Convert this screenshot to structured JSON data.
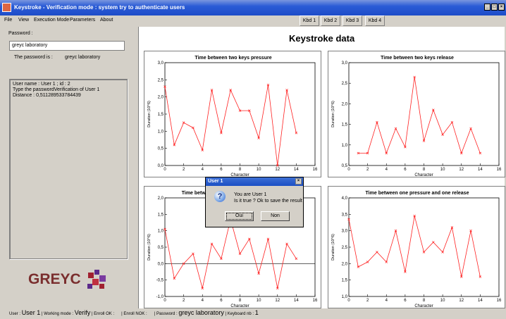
{
  "window": {
    "title": "Keystroke - Verification mode : system try to authenticate users"
  },
  "menu": [
    "File",
    "View",
    "Execution Mode",
    "Parameters",
    "About"
  ],
  "keyboards": [
    "Kbd 1",
    "Kbd 2",
    "Kbd 3",
    "Kbd 4"
  ],
  "left": {
    "password_label": "Password :",
    "password_value": "greyc laboratory",
    "password_is_label": "The password is :",
    "password_is_value": "greyc laboratory",
    "info_lines": [
      "User name : User 1 ; id : 2",
      "Type the passwordVerification of User 1",
      "Distance : 0,511289533784439"
    ],
    "logo_text": "GREYC"
  },
  "main": {
    "title": "Keystroke data"
  },
  "charts": [
    {
      "title": "Time between two keys pressure"
    },
    {
      "title": "Time between two keys release"
    },
    {
      "title": "Time between two pressure and one release"
    },
    {
      "title": "Time between one pressure and one release"
    }
  ],
  "chart_data": [
    {
      "type": "line",
      "title": "Time between two keys pressure",
      "xlabel": "Character",
      "ylabel": "Duration (10^6)",
      "xlim": [
        0,
        16
      ],
      "ylim": [
        0,
        3
      ],
      "xticks": [
        0,
        2,
        4,
        6,
        8,
        10,
        12,
        14,
        16
      ],
      "yticks": [
        "0,0",
        "0,5",
        "1,0",
        "1,5",
        "2,0",
        "2,5",
        "3,0"
      ],
      "x": [
        0,
        1,
        2,
        3,
        4,
        5,
        6,
        7,
        8,
        9,
        10,
        11,
        12,
        13,
        14
      ],
      "y": [
        2.3,
        0.6,
        1.25,
        1.1,
        0.45,
        2.2,
        0.95,
        2.2,
        1.6,
        1.6,
        0.8,
        2.35,
        0.0,
        2.2,
        0.95
      ]
    },
    {
      "type": "line",
      "title": "Time between two keys release",
      "xlabel": "Character",
      "ylabel": "Duration (10^6)",
      "xlim": [
        0,
        16
      ],
      "ylim": [
        0.5,
        3
      ],
      "xticks": [
        0,
        2,
        4,
        6,
        8,
        10,
        12,
        14,
        16
      ],
      "yticks": [
        "0,5",
        "1,0",
        "1,5",
        "2,0",
        "2,5",
        "3,0"
      ],
      "x": [
        1,
        2,
        3,
        4,
        5,
        6,
        7,
        8,
        9,
        10,
        11,
        12,
        13,
        14
      ],
      "y": [
        0.8,
        0.8,
        1.55,
        0.8,
        1.4,
        0.95,
        2.65,
        1.1,
        1.85,
        1.25,
        1.55,
        0.8,
        1.4,
        0.8
      ]
    },
    {
      "type": "line",
      "title": "Time between two pressure and one release",
      "xlabel": "Character",
      "ylabel": "Duration (10^6)",
      "xlim": [
        0,
        16
      ],
      "ylim": [
        -1,
        2
      ],
      "xticks": [
        0,
        2,
        4,
        6,
        8,
        10,
        12,
        14,
        16
      ],
      "yticks": [
        "-1,0",
        "-0,5",
        "0,0",
        "0,5",
        "1,0",
        "1,5",
        "2,0"
      ],
      "x": [
        0,
        1,
        2,
        3,
        4,
        5,
        6,
        7,
        8,
        9,
        10,
        11,
        12,
        13,
        14
      ],
      "y": [
        1.05,
        -0.45,
        0.0,
        0.3,
        -0.75,
        0.6,
        0.15,
        1.35,
        0.3,
        0.75,
        -0.3,
        0.75,
        -0.75,
        0.6,
        0.15
      ]
    },
    {
      "type": "line",
      "title": "Time between one pressure and one release",
      "xlabel": "Character",
      "ylabel": "Duration (10^6)",
      "xlim": [
        0,
        16
      ],
      "ylim": [
        1,
        4
      ],
      "xticks": [
        0,
        2,
        4,
        6,
        8,
        10,
        12,
        14,
        16
      ],
      "yticks": [
        "1,0",
        "1,5",
        "2,0",
        "2,5",
        "3,0",
        "3,5",
        "4,0"
      ],
      "x": [
        0,
        1,
        2,
        3,
        4,
        5,
        6,
        7,
        8,
        9,
        10,
        11,
        12,
        13,
        14
      ],
      "y": [
        3.35,
        1.9,
        2.05,
        2.35,
        2.05,
        3.0,
        1.75,
        3.45,
        2.35,
        2.65,
        2.35,
        3.1,
        1.6,
        3.0,
        1.6
      ]
    }
  ],
  "dialog": {
    "title": "User 1",
    "line1": "You are User 1",
    "line2": "Is it true ? Ok to save the result",
    "yes_label": "Oui",
    "no_label": "Non"
  },
  "status": {
    "user_label": "User :",
    "user_value": "User 1",
    "mode_label": "| Working mode :",
    "mode_value": "Verify",
    "enroll_ok": "| Enroll OK :",
    "enroll_nok": "| Enroll NOK :",
    "password_label": "| Password :",
    "password_value": "greyc laboratory",
    "keyboard_label": "| Keyboard nb :",
    "keyboard_value": "1"
  }
}
